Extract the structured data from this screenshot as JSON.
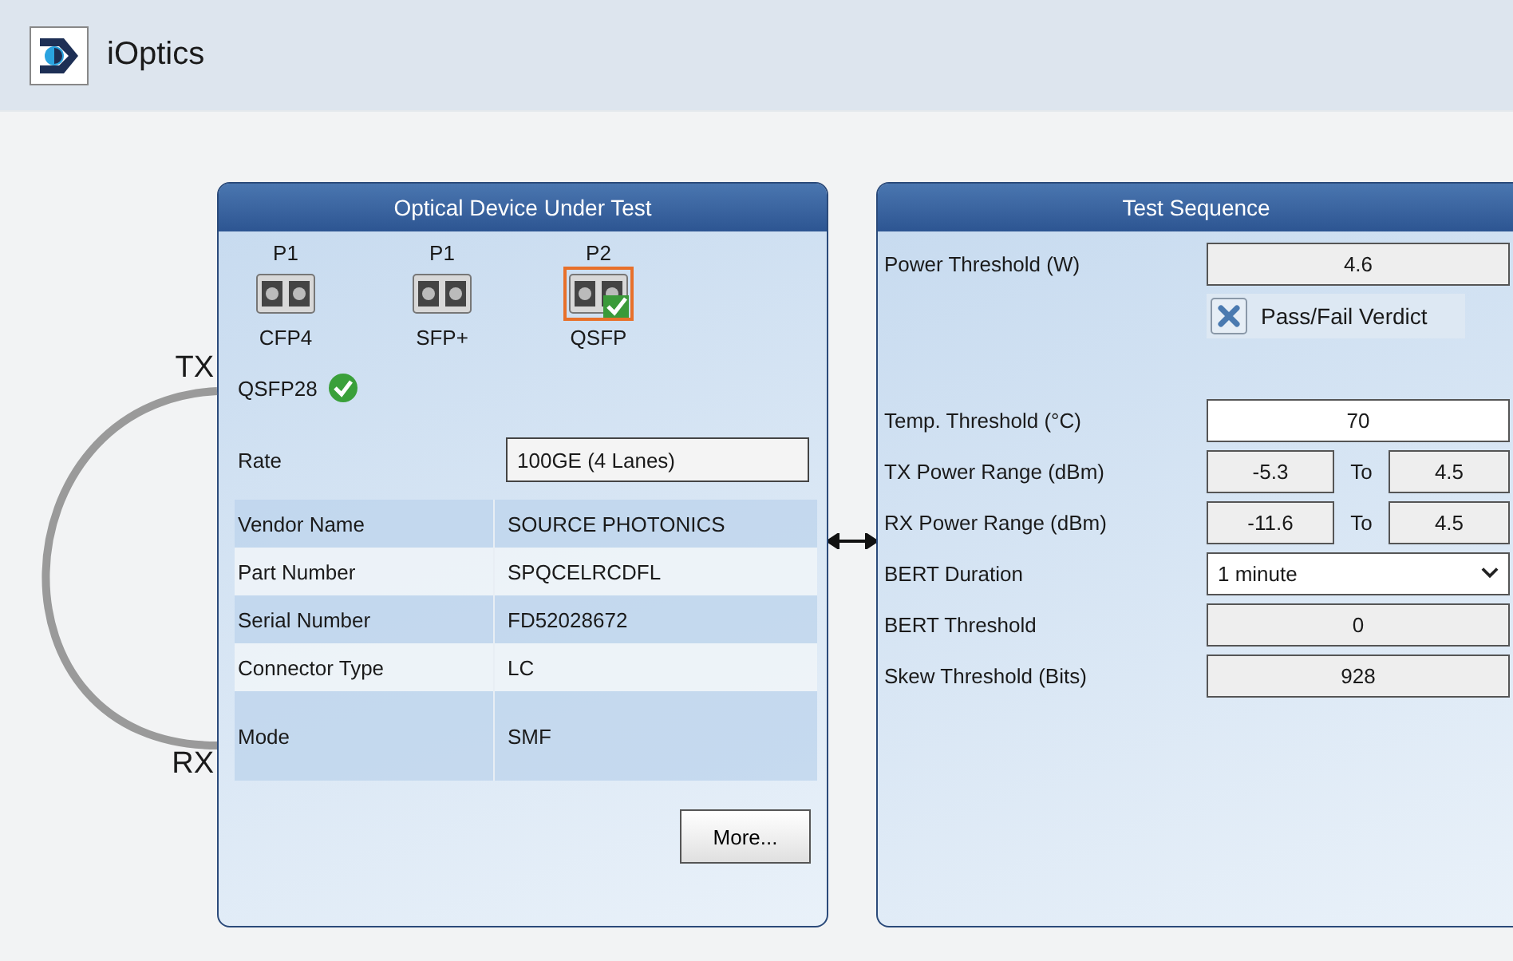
{
  "window": {
    "title": "iOptics"
  },
  "loop": {
    "tx_label": "TX",
    "rx_label": "RX"
  },
  "device_panel": {
    "title": "Optical Device Under Test",
    "transceivers": [
      {
        "port": "P1",
        "name": "CFP4",
        "selected": false
      },
      {
        "port": "P1",
        "name": "SFP+",
        "selected": false
      },
      {
        "port": "P2",
        "name": "QSFP",
        "selected": true
      }
    ],
    "detected": {
      "label": "QSFP28",
      "verified": true
    },
    "rate": {
      "label": "Rate",
      "value": "100GE (4 Lanes)"
    },
    "info_rows": [
      {
        "label": "Vendor Name",
        "value": "SOURCE PHOTONICS"
      },
      {
        "label": "Part Number",
        "value": "SPQCELRCDFL"
      },
      {
        "label": "Serial Number",
        "value": "FD52028672"
      },
      {
        "label": "Connector Type",
        "value": "LC"
      },
      {
        "label": "Mode",
        "value": "SMF",
        "tall": true
      }
    ],
    "more_button": "More..."
  },
  "test_sequence": {
    "title": "Test Sequence",
    "rows": [
      {
        "kind": "input",
        "label": "Power Threshold (W)",
        "value": "4.6",
        "editable": false
      },
      {
        "kind": "checkbox",
        "label": "Pass/Fail Verdict",
        "checked": false
      },
      {
        "kind": "input",
        "label": "Temp. Threshold (°C)",
        "value": "70",
        "editable": true
      },
      {
        "kind": "range",
        "label": "TX Power Range (dBm)",
        "min": "-5.3",
        "to": "To",
        "max": "4.5"
      },
      {
        "kind": "range",
        "label": "RX Power Range (dBm)",
        "min": "-11.6",
        "to": "To",
        "max": "4.5"
      },
      {
        "kind": "dropdown",
        "label": "BERT Duration",
        "value": "1 minute"
      },
      {
        "kind": "input",
        "label": "BERT Threshold",
        "value": "0",
        "editable": false
      },
      {
        "kind": "input",
        "label": "Skew Threshold (Bits)",
        "value": "928",
        "editable": false
      }
    ]
  }
}
